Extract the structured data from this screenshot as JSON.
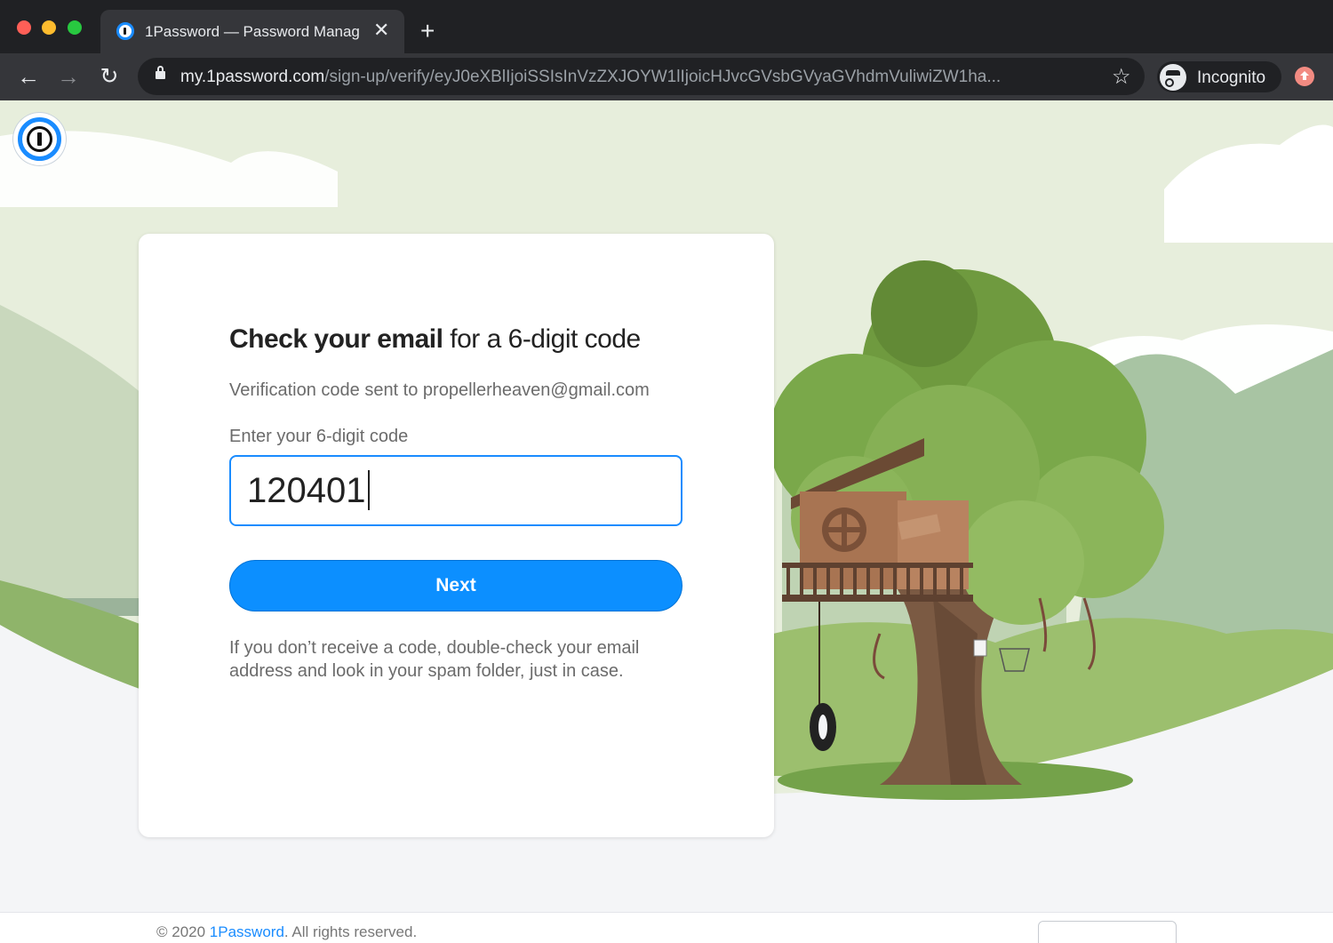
{
  "browser": {
    "tab_title": "1Password — Password Manag",
    "tab_close": "✕",
    "new_tab": "+",
    "url_host": "my.1password.com",
    "url_path": "/sign-up/verify/eyJ0eXBlIjoiSSIsInVzZXJOYW1lIjoicHJvcGVsbGVyaGVhdmVuliwiZW1ha...",
    "back": "←",
    "forward": "→",
    "reload": "↻",
    "star": "☆",
    "incognito_label": "Incognito"
  },
  "page": {
    "heading_bold": "Check your email",
    "heading_rest": " for a 6-digit code",
    "sent_text": "Verification code sent to propellerheaven@gmail.com",
    "code_label": "Enter your 6-digit code",
    "code_value": "120401",
    "next_label": "Next",
    "help_text": "If you don’t receive a code, double-check your email address and look in your spam folder, just in case."
  },
  "footer": {
    "copyright": "© 2020 ",
    "brand_link": "1Password",
    "rights": ". All rights reserved."
  },
  "colors": {
    "accent": "#0c8fff",
    "chrome_dark": "#202124",
    "chrome_tab": "#35363a"
  }
}
